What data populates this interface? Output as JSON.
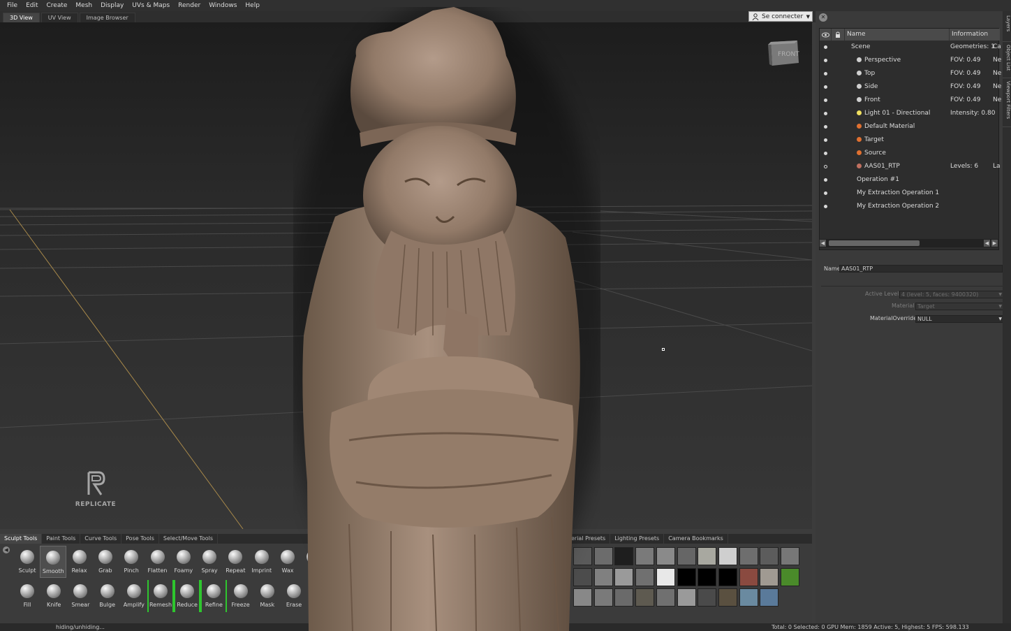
{
  "menu": [
    "File",
    "Edit",
    "Create",
    "Mesh",
    "Display",
    "UVs & Maps",
    "Render",
    "Windows",
    "Help"
  ],
  "view_tabs": [
    "3D View",
    "UV View",
    "Image Browser"
  ],
  "connect": {
    "label": "Se connecter"
  },
  "viewport": {
    "cube_label": "FRONT",
    "watermark": "REPLICATE"
  },
  "outliner": {
    "col_name": "Name",
    "col_info": "Information",
    "rows": [
      {
        "name": "Scene",
        "info": "Geometries: 1",
        "info2": "Ca",
        "icon": "none"
      },
      {
        "name": "Perspective",
        "info": "FOV: 0.49",
        "info2": "Ne",
        "icon": "camera"
      },
      {
        "name": "Top",
        "info": "FOV: 0.49",
        "info2": "Ne",
        "icon": "camera"
      },
      {
        "name": "Side",
        "info": "FOV: 0.49",
        "info2": "Ne",
        "icon": "camera"
      },
      {
        "name": "Front",
        "info": "FOV: 0.49",
        "info2": "Ne",
        "icon": "camera"
      },
      {
        "name": "Light 01 - Directional",
        "info": "Intensity: 0.80",
        "info2": "",
        "icon": "light"
      },
      {
        "name": "Default Material",
        "info": "",
        "info2": "",
        "icon": "material"
      },
      {
        "name": "Target",
        "info": "",
        "info2": "",
        "icon": "material"
      },
      {
        "name": "Source",
        "info": "",
        "info2": "",
        "icon": "material"
      },
      {
        "name": "AAS01_RTP",
        "info": "Levels: 6",
        "info2": "La",
        "icon": "mesh"
      },
      {
        "name": "Operation #1",
        "info": "",
        "info2": "",
        "icon": "none"
      },
      {
        "name": "My Extraction Operation 1",
        "info": "",
        "info2": "",
        "icon": "none"
      },
      {
        "name": "My Extraction Operation 2",
        "info": "",
        "info2": "",
        "icon": "none"
      }
    ]
  },
  "properties": {
    "name_label": "Name",
    "name_value": "AAS01_RTP",
    "active_level_label": "Active Level",
    "active_level_value": "4 (level: 5, faces: 9400320)",
    "material_label": "Material",
    "material_value": "Target",
    "override_label": "MaterialOverride",
    "override_value": "NULL"
  },
  "side_tabs": [
    "Layers",
    "Object List",
    "Viewport Filters"
  ],
  "bottom_tabs": [
    "Sculpt Tools",
    "Paint Tools",
    "Curve Tools",
    "Pose Tools",
    "Select/Move Tools",
    "erial Presets",
    "Lighting Presets",
    "Camera Bookmarks"
  ],
  "tools_row1": [
    "Sculpt",
    "Smooth",
    "Relax",
    "Grab",
    "Pinch",
    "Flatten",
    "Foamy",
    "Spray",
    "Repeat",
    "Imprint",
    "Wax",
    "Sc"
  ],
  "tools_row2": [
    "Fill",
    "Knife",
    "Smear",
    "Bulge",
    "Amplify",
    "Remesh",
    "Reduce",
    "Refine",
    "Freeze",
    "Mask",
    "Erase"
  ],
  "status": {
    "left": "hiding/unhiding...",
    "right": "Total: 0  Selected: 0 GPU Mem: 1859  Active: 5, Highest: 5  FPS: 598.133"
  }
}
